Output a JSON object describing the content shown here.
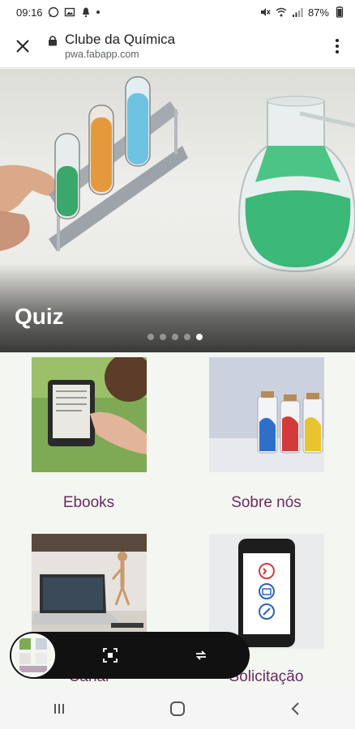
{
  "status": {
    "time": "09:16",
    "battery": "87%",
    "left_icons": [
      "whatsapp-icon",
      "image-icon",
      "notification-icon"
    ],
    "right_icons": [
      "mute-icon",
      "wifi-icon",
      "signal-icon",
      "battery-icon"
    ]
  },
  "browser": {
    "title": "Clube da Química",
    "url": "pwa.fabapp.com"
  },
  "hero": {
    "title": "Quiz",
    "slides_total": 5,
    "active_slide": 5
  },
  "tiles": [
    {
      "label": "Ebooks",
      "icon": "ereader-photo"
    },
    {
      "label": "Sobre nós",
      "icon": "ink-bottles-photo"
    },
    {
      "label": "Canal",
      "icon": "laptop-photo"
    },
    {
      "label": "Solicitação",
      "icon": "phone-contact-photo"
    }
  ],
  "float_bar": {
    "buttons": [
      "screenshot-capture-icon",
      "rotate-icon"
    ]
  },
  "nav": {
    "buttons": [
      "recents-icon",
      "home-icon",
      "back-icon"
    ]
  },
  "colors": {
    "accent": "#6b2c5f",
    "background": "#f3f6f1",
    "flask_green": "#3cb878"
  }
}
